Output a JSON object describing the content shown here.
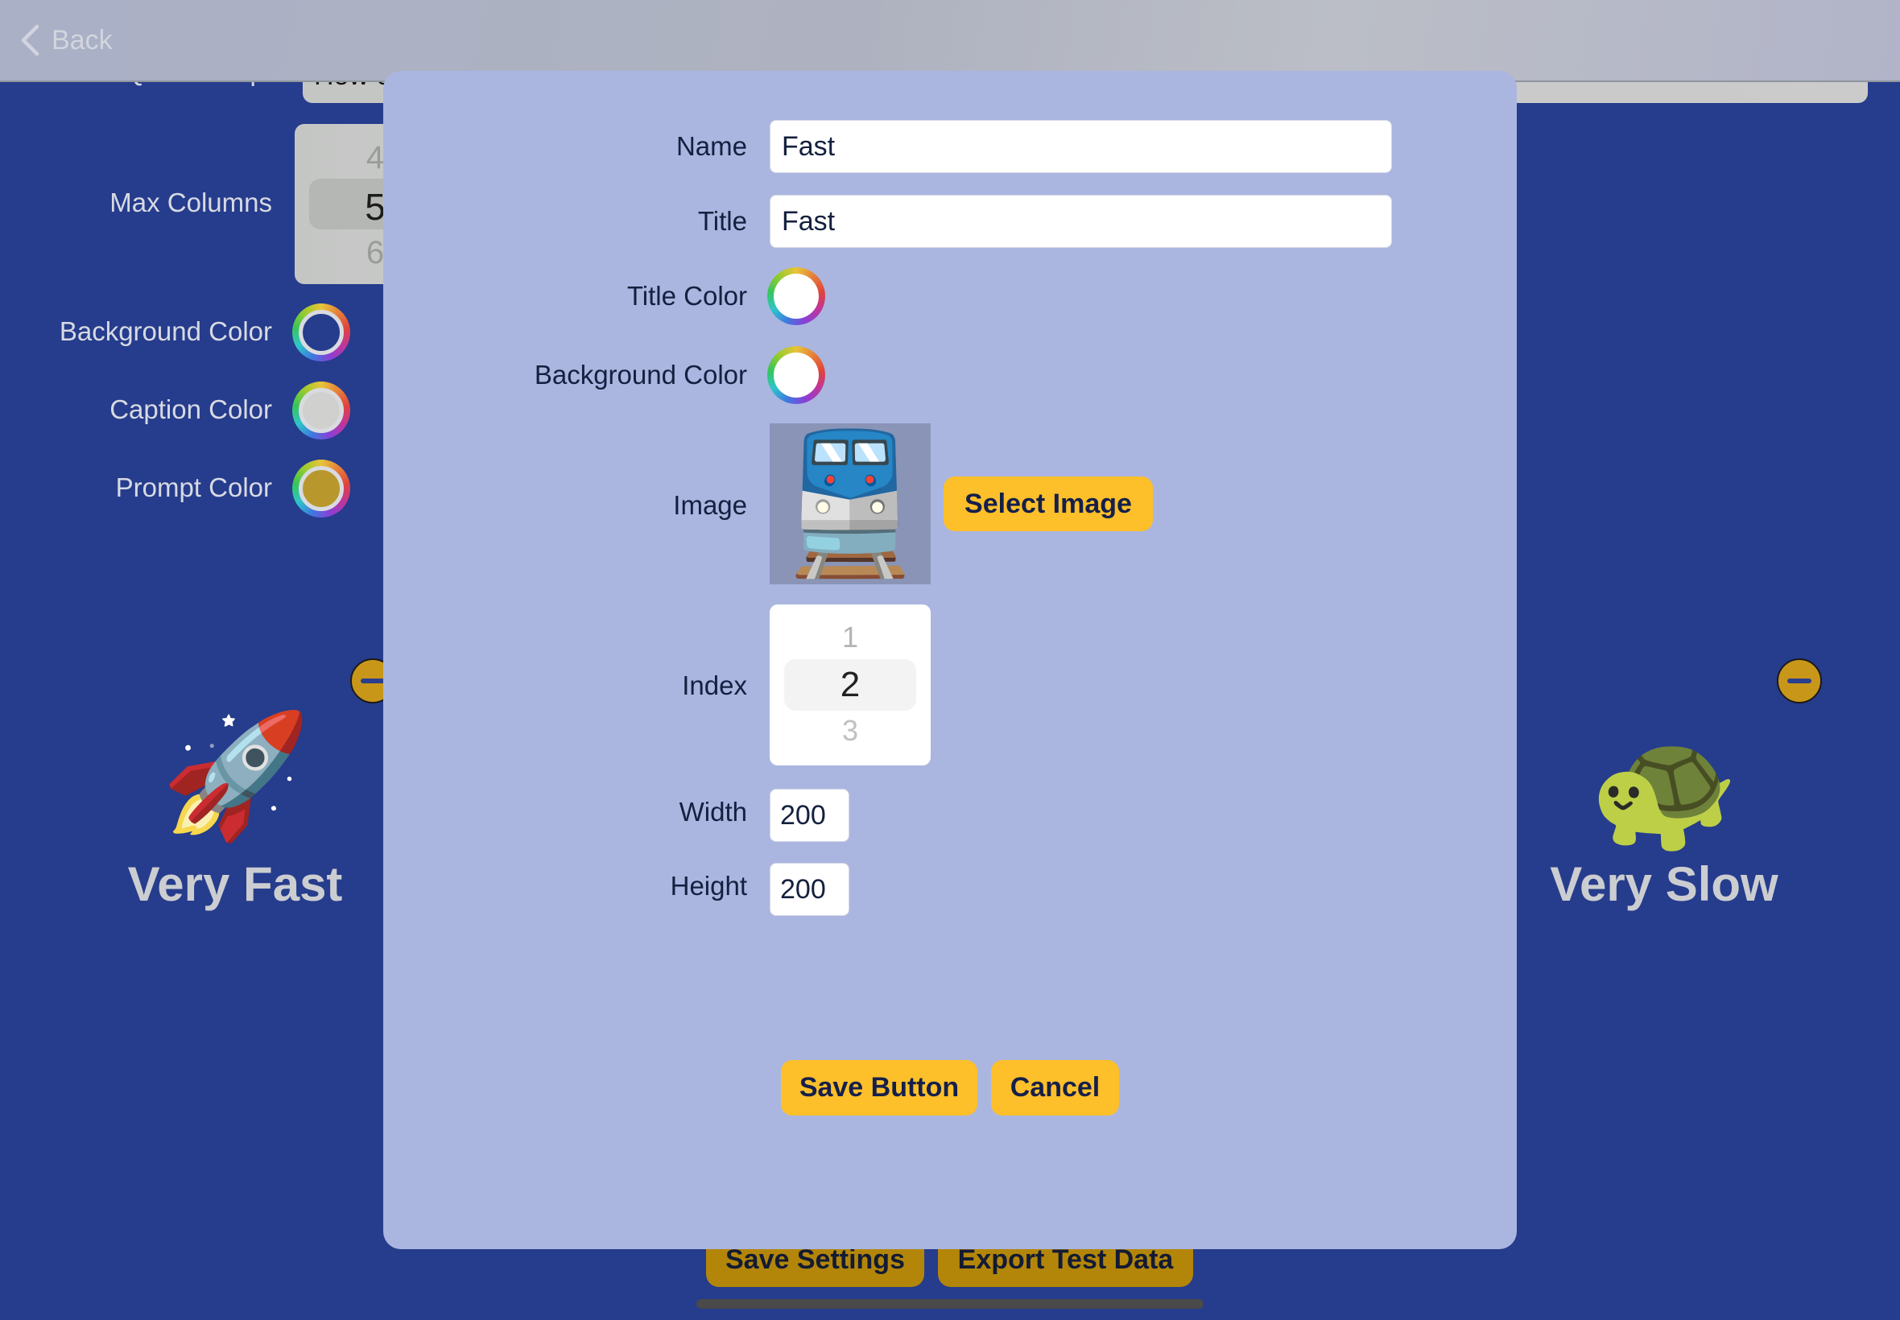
{
  "nav": {
    "back_label": "Back"
  },
  "settings": {
    "quiz_prompt_label": "Quiz Prompt",
    "quiz_prompt_value": "How o",
    "max_columns_label": "Max Columns",
    "max_columns_options": [
      "4",
      "5",
      "6"
    ],
    "max_columns_selected": "5",
    "background_color_label": "Background Color",
    "background_color": "#263c8c",
    "caption_color_label": "Caption Color",
    "caption_color": "#d0d1cf",
    "prompt_color_label": "Prompt Color",
    "prompt_color": "#b8982c"
  },
  "items": [
    {
      "emoji": "🚀",
      "icon": "rocket-icon",
      "caption": "Very Fast"
    },
    {
      "emoji": "🐢",
      "icon": "turtle-icon",
      "caption": "Very Slow"
    }
  ],
  "footer": {
    "save_settings_label": "Save Settings",
    "export_label": "Export Test Data"
  },
  "modal": {
    "name_label": "Name",
    "name_value": "Fast",
    "title_label": "Title",
    "title_value": "Fast",
    "title_color_label": "Title Color",
    "title_color": "#ffffff",
    "background_color_label": "Background Color",
    "background_color": "#ffffff",
    "image_label": "Image",
    "image_emoji": "🚆",
    "select_image_label": "Select Image",
    "index_label": "Index",
    "index_options": [
      "1",
      "2",
      "3"
    ],
    "index_selected": "2",
    "width_label": "Width",
    "width_value": "200",
    "height_label": "Height",
    "height_value": "200",
    "save_label": "Save Button",
    "cancel_label": "Cancel"
  },
  "colors": {
    "app_background": "#263c8c",
    "modal_background": "#aab6e0",
    "accent_button": "#fdbf2a",
    "button_text": "#15204a"
  }
}
